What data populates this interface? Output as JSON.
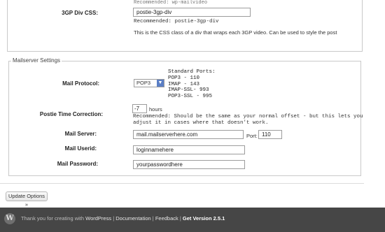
{
  "top": {
    "cut_text": "Recommended: wp-mailvideo",
    "gp_label": "3GP Div CSS:",
    "gp_value": "postie-3gp-div",
    "gp_recommended": "Recommended: postie-3gp-div",
    "gp_help": "This is the CSS class of a div that wraps each 3GP video. Can be used to style the post"
  },
  "mailserver": {
    "legend": "Mailserver Settings",
    "protocol_label": "Mail Protocol:",
    "protocol_value": "POP3",
    "ports_text": "Standard Ports:\nPOP3 - 110\nIMAP - 143\nIMAP-SSL- 993\nPOP3-SSL - 995",
    "time_label": "Postie Time Correction:",
    "time_value": "-7",
    "time_unit": "hours",
    "time_help_line1": "Recommended: Should be the same as your normal offset - but this lets you",
    "time_help_line2": "adjust it in cases where that doesn't work.",
    "server_label": "Mail Server:",
    "server_value": "mail.mailserverhere.com",
    "port_label": "Port:",
    "port_value": "110",
    "userid_label": "Mail Userid:",
    "userid_value": "loginnamehere",
    "password_label": "Mail Password:",
    "password_value": "yourpasswordhere"
  },
  "update_button": "Update Options »",
  "footer": {
    "logo": "W",
    "thanks": "Thank you for creating with ",
    "wordpress": "WordPress",
    "documentation": "Documentation",
    "feedback": "Feedback",
    "get_version": "Get Version 2.5.1",
    "sep": " | "
  }
}
